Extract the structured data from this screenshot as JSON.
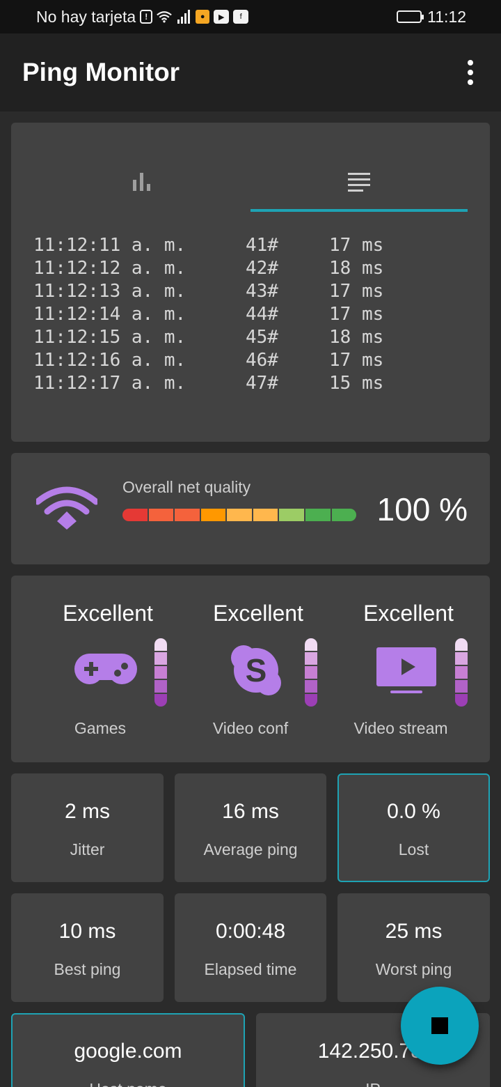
{
  "status_bar": {
    "carrier": "No hay tarjeta",
    "time": "11:12",
    "battery_level": 1.0
  },
  "app_bar": {
    "title": "Ping Monitor",
    "menu_icon": "more-vert-icon"
  },
  "tabs": [
    {
      "icon": "bar-chart-icon",
      "selected": false
    },
    {
      "icon": "list-icon",
      "selected": true
    }
  ],
  "ping_log": [
    {
      "time": "11:12:11 a. m.",
      "seq": "41#",
      "latency": "17 ms"
    },
    {
      "time": "11:12:12 a. m.",
      "seq": "42#",
      "latency": "18 ms"
    },
    {
      "time": "11:12:13 a. m.",
      "seq": "43#",
      "latency": "17 ms"
    },
    {
      "time": "11:12:14 a. m.",
      "seq": "44#",
      "latency": "17 ms"
    },
    {
      "time": "11:12:15 a. m.",
      "seq": "45#",
      "latency": "18 ms"
    },
    {
      "time": "11:12:16 a. m.",
      "seq": "46#",
      "latency": "17 ms"
    },
    {
      "time": "11:12:17 a. m.",
      "seq": "47#",
      "latency": "15 ms"
    }
  ],
  "quality": {
    "label": "Overall net quality",
    "percent": "100 %",
    "level": 1.0,
    "icon": "wifi-icon",
    "bar_colors": [
      "#e53935",
      "#f4623c",
      "#f4623c",
      "#ff9800",
      "#ffb74d",
      "#ffb74d",
      "#9ccc65",
      "#4caf50",
      "#4caf50"
    ]
  },
  "use_cases": [
    {
      "status": "Excellent",
      "label": "Games",
      "icon": "gamepad-icon"
    },
    {
      "status": "Excellent",
      "label": "Video conf",
      "icon": "skype-icon"
    },
    {
      "status": "Excellent",
      "label": "Video stream",
      "icon": "video-stream-icon"
    }
  ],
  "meter_colors": [
    "#f1dcf3",
    "#d9a6e1",
    "#c77fd3",
    "#b163c7",
    "#9c3fb5"
  ],
  "accent_color": "#b57ee8",
  "stats": [
    {
      "value": "2 ms",
      "label": "Jitter"
    },
    {
      "value": "16 ms",
      "label": "Average ping"
    },
    {
      "value": "0.0 %",
      "label": "Lost"
    },
    {
      "value": "10 ms",
      "label": "Best ping"
    },
    {
      "value": "0:00:48",
      "label": "Elapsed time"
    },
    {
      "value": "25 ms",
      "label": "Worst ping"
    }
  ],
  "host": {
    "name": "google.com",
    "name_label": "Host name",
    "ip": "142.250.78.",
    "ip_label": "IP"
  },
  "fab": {
    "icon": "stop-icon"
  }
}
